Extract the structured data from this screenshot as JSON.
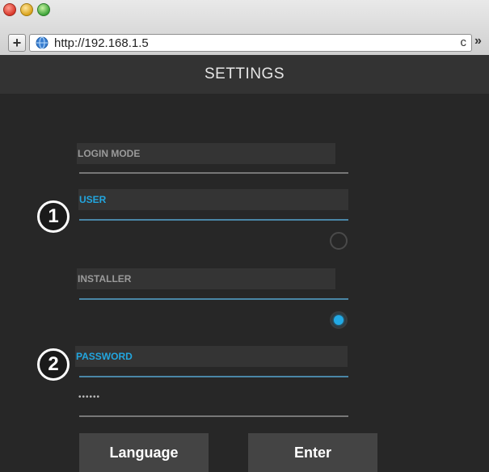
{
  "browser": {
    "url": "http://192.168.1.5",
    "add_tab_label": "+",
    "reload_label": "c",
    "overflow_label": "»"
  },
  "app": {
    "title": "SETTINGS"
  },
  "form": {
    "login_mode_label": "LOGIN MODE",
    "user_label": "USER",
    "user_selected": false,
    "installer_label": "INSTALLER",
    "installer_selected": true,
    "password_label": "PASSWORD",
    "password_value": "••••••"
  },
  "callouts": [
    "1",
    "2"
  ],
  "buttons": {
    "language": "Language",
    "enter": "Enter"
  },
  "colors": {
    "accent": "#22a6df",
    "background": "#272727",
    "header": "#333333",
    "button": "#444444"
  }
}
